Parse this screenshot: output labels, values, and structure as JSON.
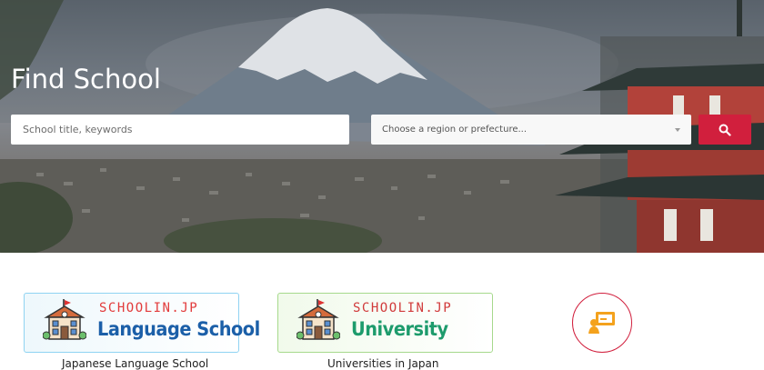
{
  "hero": {
    "title": "Find School",
    "search": {
      "placeholder": "School title, keywords"
    },
    "region_select": {
      "selected": "Choose a region or prefecture..."
    },
    "search_button_icon": "search-icon"
  },
  "cards": [
    {
      "brand": "SCHOOLIN.JP",
      "title": "Language School",
      "caption": "Japanese Language School",
      "accent": "#1b5fa8",
      "border": "#8fd3f2"
    },
    {
      "brand": "SCHOOLIN.JP",
      "title": "University",
      "caption": "Universities in Japan",
      "accent": "#1d9b6c",
      "border": "#a6d98c"
    }
  ],
  "third_item": {
    "icon": "online-lesson-icon"
  },
  "colors": {
    "primary": "#d11f3d",
    "icon_orange": "#f4a21d"
  }
}
